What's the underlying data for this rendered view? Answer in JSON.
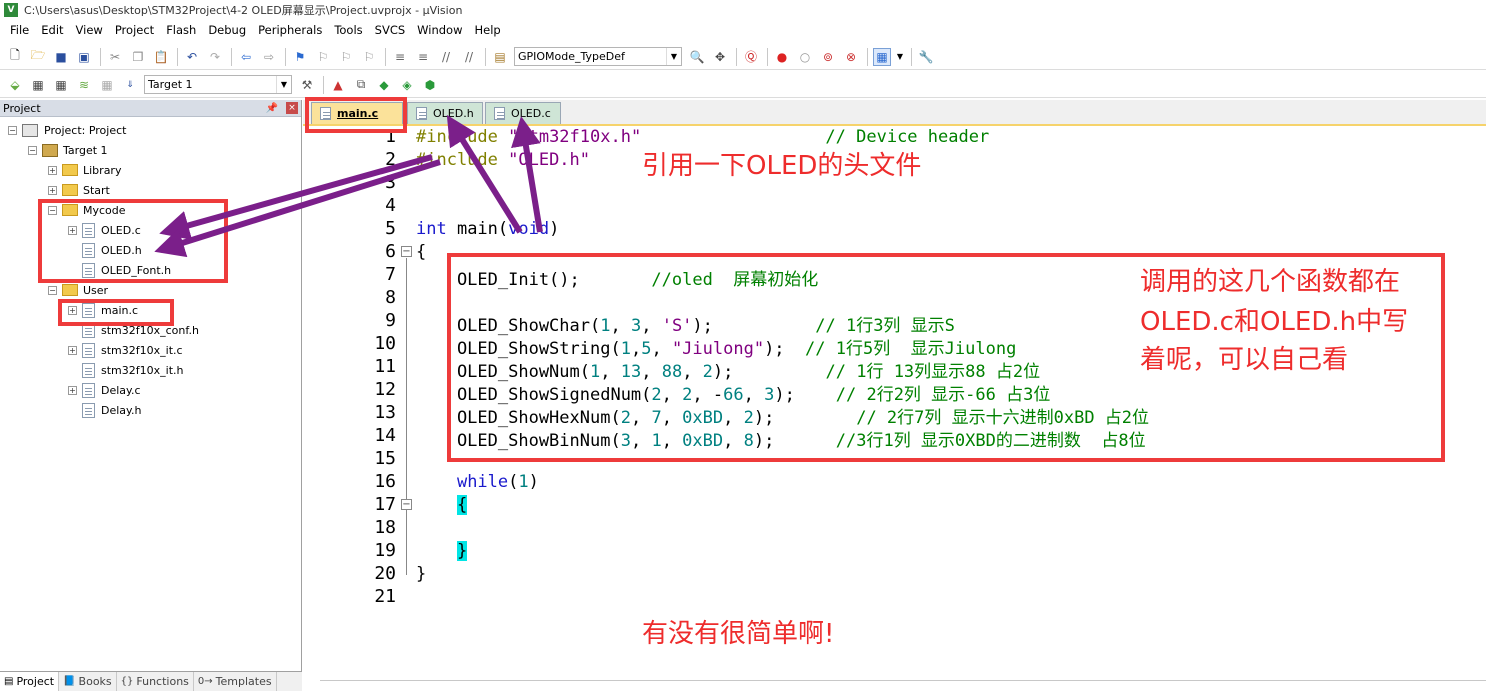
{
  "window": {
    "title": "C:\\Users\\asus\\Desktop\\STM32Project\\4-2 OLED屏幕显示\\Project.uvprojx - µVision",
    "app_icon": "V"
  },
  "menu": [
    "File",
    "Edit",
    "View",
    "Project",
    "Flash",
    "Debug",
    "Peripherals",
    "Tools",
    "SVCS",
    "Window",
    "Help"
  ],
  "toolbar": {
    "find_combo": "GPIOMode_TypeDef",
    "target_combo": "Target 1"
  },
  "project_panel": {
    "title": "Project",
    "tree": [
      {
        "label": "Project: Project",
        "kind": "project",
        "exp": "−"
      },
      {
        "label": "Target 1",
        "kind": "target",
        "exp": "−"
      },
      {
        "label": "Library",
        "kind": "folder",
        "exp": "+"
      },
      {
        "label": "Start",
        "kind": "folder",
        "exp": "+"
      },
      {
        "label": "Mycode",
        "kind": "folder",
        "exp": "−"
      },
      {
        "label": "OLED.c",
        "kind": "file",
        "exp": "+"
      },
      {
        "label": "OLED.h",
        "kind": "file",
        "exp": ""
      },
      {
        "label": "OLED_Font.h",
        "kind": "file",
        "exp": ""
      },
      {
        "label": "User",
        "kind": "folder",
        "exp": "−"
      },
      {
        "label": "main.c",
        "kind": "file",
        "exp": "+"
      },
      {
        "label": "stm32f10x_conf.h",
        "kind": "file",
        "exp": ""
      },
      {
        "label": "stm32f10x_it.c",
        "kind": "file",
        "exp": "+"
      },
      {
        "label": "stm32f10x_it.h",
        "kind": "file",
        "exp": ""
      },
      {
        "label": "Delay.c",
        "kind": "file",
        "exp": "+"
      },
      {
        "label": "Delay.h",
        "kind": "file",
        "exp": ""
      }
    ],
    "tabs": [
      "Project",
      "Books",
      "Functions",
      "Templates"
    ]
  },
  "editor": {
    "tabs": [
      {
        "label": "main.c",
        "active": true
      },
      {
        "label": "OLED.h",
        "active": false
      },
      {
        "label": "OLED.c",
        "active": false
      }
    ],
    "line_numbers": [
      "1",
      "2",
      "3",
      "4",
      "5",
      "6",
      "7",
      "8",
      "9",
      "10",
      "11",
      "12",
      "13",
      "14",
      "15",
      "16",
      "17",
      "18",
      "19",
      "20",
      "21"
    ]
  },
  "annotations": {
    "include_note": "引用一下OLED的头文件",
    "functions_note_1": "调用的这几个函数都在",
    "functions_note_2": "OLED.c和OLED.h中写",
    "functions_note_3": "着呢，可以自己看",
    "simple_note": "有没有很简单啊!",
    "color": "#ee3b3b"
  }
}
